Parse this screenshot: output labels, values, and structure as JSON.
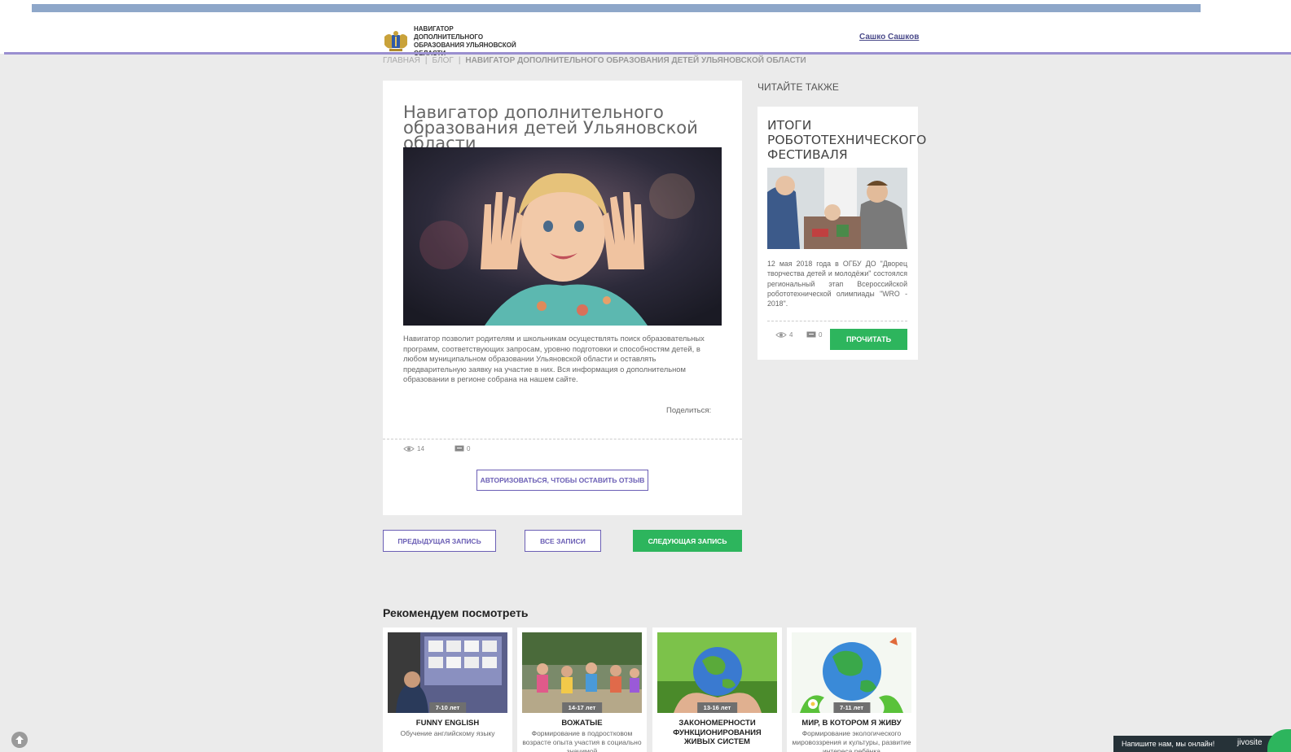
{
  "header": {
    "logo_text": "Навигатор дополнительного образования Ульяновской области",
    "user_name": "Сашко Сашков"
  },
  "breadcrumbs": {
    "home": "Главная",
    "blog": "Блог",
    "current": "Навигатор дополнительного образования детей Ульяновской области"
  },
  "article": {
    "title": "Навигатор дополнительного образования детей Ульяновской области",
    "text": "Навигатор позволит родителям и школьникам осуществлять поиск образовательных программ, соответствующих запросам, уровню подготовки и способностям детей, в любом муниципальном образовании Ульяновской области и оставлять предварительную заявку на участие в них. Вся информация о дополнительном образовании в регионе собрана на нашем сайте.",
    "share_label": "Поделиться:",
    "views": "14",
    "comments": "0",
    "auth_button": "Авторизоваться, чтобы оставить отзыв"
  },
  "nav_buttons": {
    "prev": "Предыдущая запись",
    "all": "Все записи",
    "next": "Следующая запись"
  },
  "sidebar": {
    "title": "Читайте также",
    "card": {
      "title": "Итоги робототехнического фестиваля",
      "text": "12 мая 2018 года в ОГБУ ДО \"Дворец творчества детей и молодёжи\" состоялся региональный этап Всероссийской робототехнической олимпиады \"WRO - 2018\".",
      "views": "4",
      "comments": "0",
      "button": "Прочитать"
    }
  },
  "recommendations": {
    "title": "Рекомендуем посмотреть",
    "items": [
      {
        "age": "7-10 лет",
        "title": "Funny English",
        "desc": "Обучение английскому языку"
      },
      {
        "age": "14-17 лет",
        "title": "Вожатые",
        "desc": "Формирование в подростковом возрасте опыта участия в социально значимой"
      },
      {
        "age": "13-16 лет",
        "title": "Закономерности функционирования живых систем",
        "desc": ""
      },
      {
        "age": "7-11 лет",
        "title": "Мир, в котором я живу",
        "desc": "Формирование экологического мировоззрения и культуры, развитие интереса ребёнка"
      }
    ]
  },
  "chat": {
    "label": "Напишите нам, мы онлайн!",
    "brand": "jivosite"
  },
  "colors": {
    "accent": "#6b5fb5",
    "green": "#2db55d",
    "top_bar": "#8ea7c9",
    "header_line": "#9a8fd0"
  }
}
